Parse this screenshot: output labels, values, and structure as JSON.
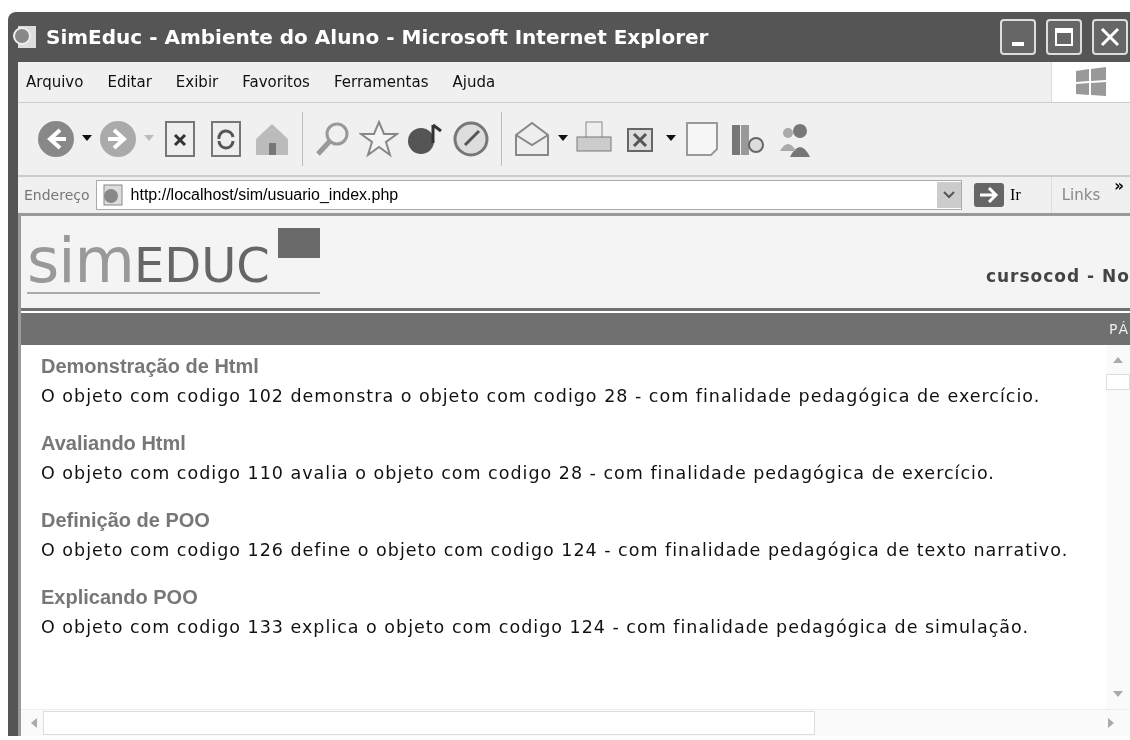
{
  "window": {
    "title": "SimEduc - Ambiente do Aluno - Microsoft Internet Explorer"
  },
  "menu": [
    "Arquivo",
    "Editar",
    "Exibir",
    "Favoritos",
    "Ferramentas",
    "Ajuda"
  ],
  "toolbar": [
    {
      "kind": "back"
    },
    {
      "kind": "dropdown",
      "disabled": false
    },
    {
      "kind": "forward"
    },
    {
      "kind": "dropdown",
      "disabled": true
    },
    {
      "kind": "stop"
    },
    {
      "kind": "refresh"
    },
    {
      "kind": "home"
    },
    {
      "kind": "separator"
    },
    {
      "kind": "search"
    },
    {
      "kind": "favorites"
    },
    {
      "kind": "media"
    },
    {
      "kind": "history"
    },
    {
      "kind": "separator"
    },
    {
      "kind": "mail"
    },
    {
      "kind": "dropdown",
      "disabled": false
    },
    {
      "kind": "print"
    },
    {
      "kind": "excel"
    },
    {
      "kind": "dropdown",
      "disabled": false
    },
    {
      "kind": "note"
    },
    {
      "kind": "research"
    },
    {
      "kind": "messenger"
    }
  ],
  "address_bar": {
    "label": "Endereço",
    "value": "http://localhost/sim/usuario_index.php",
    "go": "Ir",
    "links": "Links",
    "more": "»"
  },
  "page": {
    "logo": {
      "light": "sim",
      "dark": "EDUC"
    },
    "header_text": "cursocod - No",
    "nav_text": "PÁ",
    "items": [
      {
        "title": "Demonstração de Html",
        "text": "O objeto com codigo 102 demonstra o objeto com codigo 28 - com finalidade pedagógica de exercício."
      },
      {
        "title": "Avaliando Html",
        "text": "O objeto com codigo 110 avalia o objeto com codigo 28 - com finalidade pedagógica de exercício."
      },
      {
        "title": "Definição de POO",
        "text": "O objeto com codigo 126 define o objeto com codigo 124 - com finalidade pedagógica de texto narrativo."
      },
      {
        "title": "Explicando POO",
        "text": "O objeto com codigo 133 explica o objeto com codigo 124 - com finalidade pedagógica de simulação."
      }
    ]
  }
}
